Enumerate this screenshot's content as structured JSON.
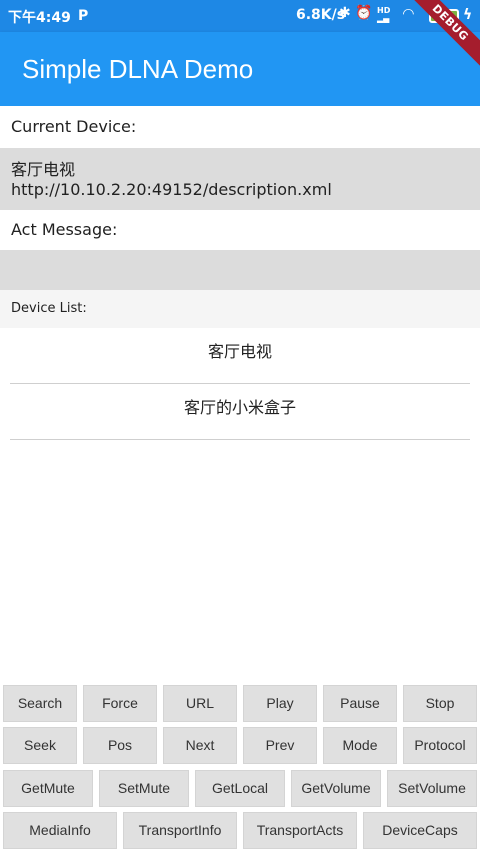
{
  "status_bar": {
    "time": "下午4:49",
    "app_icon": "P",
    "net_speed": "6.8K/s",
    "battery": "100",
    "icons": [
      "bluetooth-icon",
      "alarm-icon",
      "hd-signal-icon",
      "wifi-icon",
      "battery-icon",
      "charging-icon"
    ]
  },
  "debug_banner": "DEBUG",
  "app_bar": {
    "title": "Simple DLNA Demo",
    "color": "#2196f3"
  },
  "current_device": {
    "label": "Current Device:",
    "name": "客厅电视",
    "url": "http://10.10.2.20:49152/description.xml"
  },
  "act_message": {
    "label": "Act Message:",
    "value": ""
  },
  "device_list": {
    "label": "Device List:",
    "items": [
      "客厅电视",
      "客厅的小米盒子"
    ]
  },
  "buttons": {
    "row1": [
      "Search",
      "Force",
      "URL",
      "Play",
      "Pause",
      "Stop"
    ],
    "row2": [
      "Seek",
      "Pos",
      "Next",
      "Prev",
      "Mode",
      "Protocol"
    ],
    "row3": [
      "GetMute",
      "SetMute",
      "GetLocal",
      "GetVolume",
      "SetVolume"
    ],
    "row4": [
      "MediaInfo",
      "TransportInfo",
      "TransportActs",
      "DeviceCaps"
    ]
  }
}
